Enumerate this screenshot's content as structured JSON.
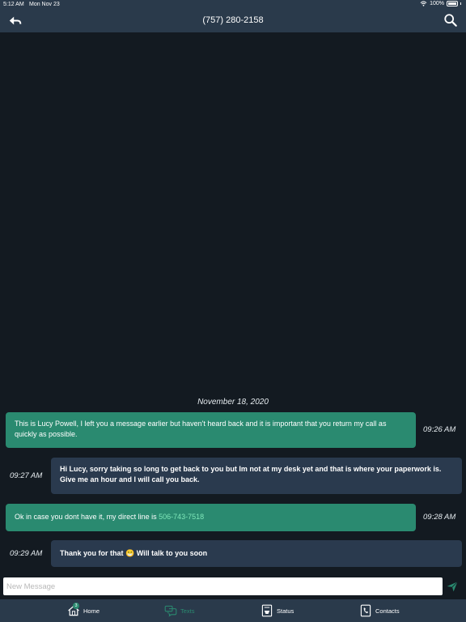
{
  "status_bar": {
    "time": "5:12 AM",
    "date": "Mon Nov 23",
    "battery": "100%"
  },
  "header": {
    "title": "(757) 280-2158"
  },
  "conversation": {
    "date_separator": "November 18, 2020",
    "messages": [
      {
        "direction": "incoming",
        "text": "This is Lucy Powell, I left you a message earlier but haven't heard back and it is important that you return my call as quickly as possible.",
        "time": "09:26 AM"
      },
      {
        "direction": "outgoing",
        "text": "Hi Lucy, sorry taking so long to get back to you but Im not at my desk yet and that is where your paperwork is. Give me an hour and I will call you back.",
        "time": "09:27 AM"
      },
      {
        "direction": "incoming",
        "text_prefix": "Ok in case you dont have it, my direct line is ",
        "link": "506-743-7518",
        "time": "09:28 AM"
      },
      {
        "direction": "outgoing",
        "text_before_emoji": "Thank you for that ",
        "emoji": "😁",
        "text_after_emoji": " Will talk to you soon",
        "time": "09:29 AM"
      }
    ]
  },
  "composer": {
    "placeholder": "New Message"
  },
  "tabs": [
    {
      "label": "Home",
      "badge": "3"
    },
    {
      "label": "Texts",
      "active": true
    },
    {
      "label": "Status"
    },
    {
      "label": "Contacts"
    }
  ],
  "colors": {
    "bar": "#2a3a4b",
    "background": "#131a21",
    "incoming": "#2a8a70",
    "outgoing": "#2a3a4e",
    "link": "#7fe7b9"
  }
}
